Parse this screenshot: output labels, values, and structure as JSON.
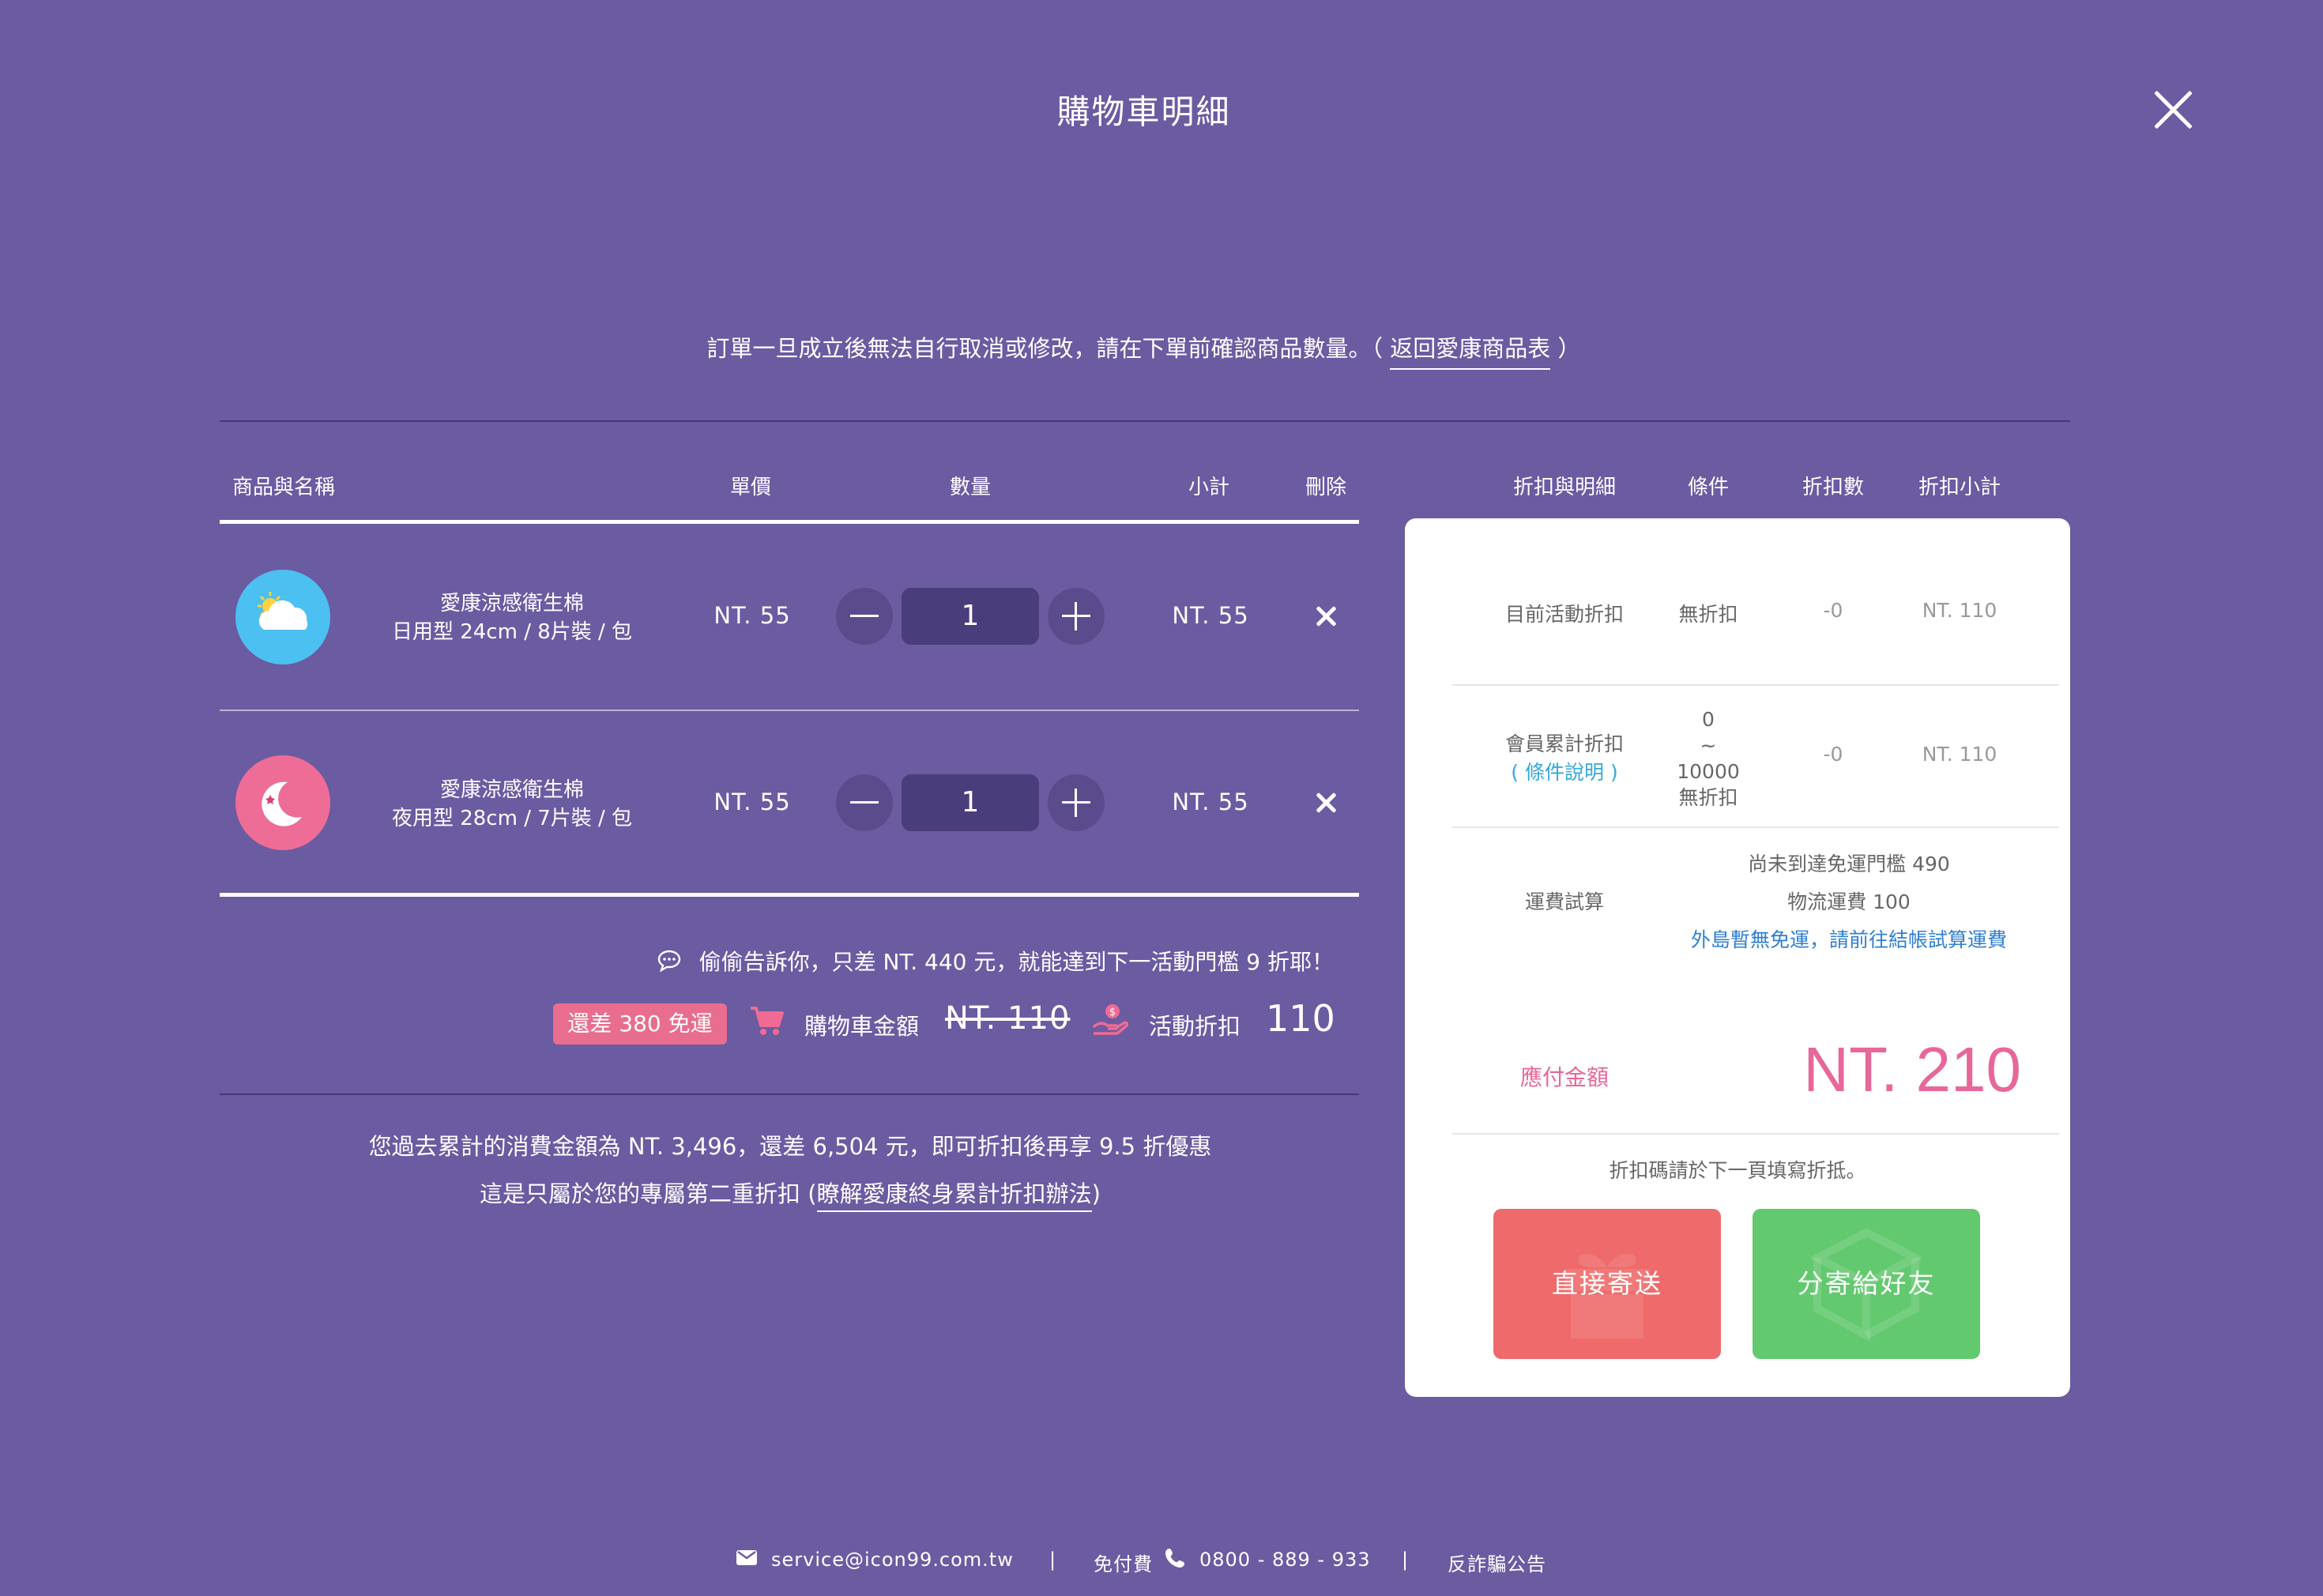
{
  "header": {
    "title": "購物車明細"
  },
  "notice": {
    "text": "訂單一旦成立後無法自行取消或修改，請在下單前確認商品數量。（",
    "link": "返回愛康商品表",
    "close": "）"
  },
  "cart_headers": {
    "name": "商品與名稱",
    "price": "單價",
    "qty": "數量",
    "subtotal": "小計",
    "delete": "刪除"
  },
  "items": [
    {
      "name": "愛康涼感衛生棉",
      "spec": "日用型 24cm / 8片裝 / 包",
      "price": "NT. 55",
      "qty": "1",
      "subtotal": "NT. 55",
      "icon": "sun-cloud-icon",
      "color": "#4cc0f0"
    },
    {
      "name": "愛康涼感衛生棉",
      "spec": "夜用型 28cm / 7片裝 / 包",
      "price": "NT. 55",
      "qty": "1",
      "subtotal": "NT. 55",
      "icon": "moon-icon",
      "color": "#ee6d97"
    }
  ],
  "hint": "偷偷告訴你，只差 NT. 440 元，就能達到下一活動門檻 9 折耶！",
  "totals": {
    "badge": "還差 380 免運",
    "cart_label": "購物車金額",
    "cart_amount": "NT. 110",
    "discount_label": "活動折扣",
    "discount_amount": "110"
  },
  "cumulative": {
    "line1": "您過去累計的消費金額為 NT. 3,496，還差 6,504 元，即可折扣後再享 9.5 折優惠",
    "line2_pre": "這是只屬於您的專屬第二重折扣 (",
    "line2_link": "瞭解愛康終身累計折扣辦法",
    "line2_post": ")"
  },
  "discount_headers": {
    "detail": "折扣與明細",
    "condition": "條件",
    "count": "折扣數",
    "subtotal": "折扣小計"
  },
  "discount_rows": [
    {
      "label": "目前活動折扣",
      "condition": "無折扣",
      "count": "-0",
      "subtotal": "NT. 110"
    },
    {
      "label": "會員累計折扣",
      "link": "條件說明",
      "condition_lines": [
        "0",
        "~",
        "10000",
        "無折扣"
      ],
      "count": "-0",
      "subtotal": "NT. 110"
    }
  ],
  "shipping": {
    "label": "運費試算",
    "line1": "尚未到達免運門檻 490",
    "line2": "物流運費 100",
    "line3": "外島暫無免運，請前往結帳試算運費"
  },
  "payable": {
    "label": "應付金額",
    "amount": "NT. 210"
  },
  "coupon_note": "折扣碼請於下一頁填寫折抵。",
  "buttons": {
    "direct": "直接寄送",
    "gift": "分寄給好友"
  },
  "footer": {
    "email": "service@icon99.com.tw",
    "sep": "|",
    "free_label": "免付費",
    "phone": "0800 - 889 - 933",
    "fraud": "反詐騙公告"
  },
  "colors": {
    "background": "#6b5ba1",
    "pink": "#e7679a",
    "red_button": "#ef6a6a",
    "green_button": "#63c96f"
  }
}
